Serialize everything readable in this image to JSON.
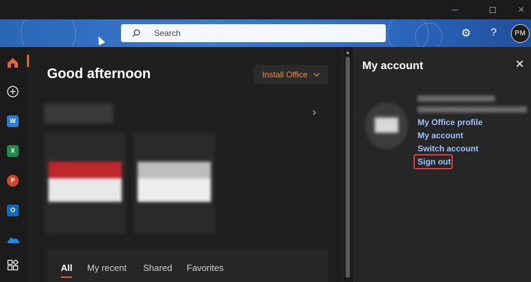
{
  "window": {
    "controls": [
      "minimize",
      "maximize",
      "close"
    ]
  },
  "header": {
    "search_placeholder": "Search",
    "avatar_initials": "PM",
    "icons": [
      "search-icon",
      "gear-icon",
      "help-icon"
    ]
  },
  "rail": {
    "items": [
      {
        "name": "home",
        "active": true
      },
      {
        "name": "create",
        "label": "+"
      },
      {
        "name": "word",
        "label": "W",
        "color": "#2b7cd3"
      },
      {
        "name": "excel",
        "label": "X",
        "color": "#1f8a4c"
      },
      {
        "name": "powerpoint",
        "label": "P",
        "color": "#d24726"
      },
      {
        "name": "outlook",
        "label": "O",
        "color": "#0f6cbd"
      },
      {
        "name": "onedrive",
        "color": "#1a8ae6"
      },
      {
        "name": "apps"
      }
    ]
  },
  "main": {
    "greeting": "Good afternoon",
    "install_label": "Install Office",
    "tabs": [
      "All",
      "My recent",
      "Shared",
      "Favorites"
    ]
  },
  "account_panel": {
    "title": "My account",
    "links": [
      "My Office profile",
      "My account",
      "Switch account",
      "Sign out"
    ]
  },
  "colors": {
    "accent": "#e3673b",
    "link": "#9ec3ff",
    "highlight_box": "#e53935",
    "header_blue": "#3c7bd0"
  }
}
